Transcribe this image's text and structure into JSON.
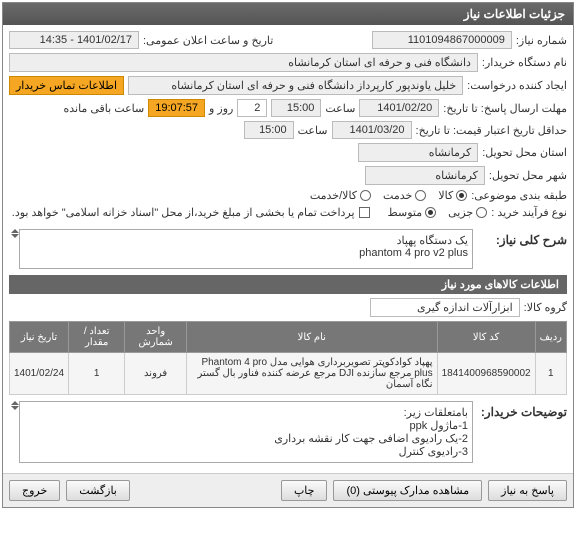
{
  "panel": {
    "title": "جزئیات اطلاعات نیاز"
  },
  "info": {
    "need_number_label": "شماره نیاز:",
    "need_number": "1101094867000009",
    "announce_label": "تاریخ و ساعت اعلان عمومی:",
    "announce_value": "1401/02/17 - 14:35",
    "buyer_name_label": "نام دستگاه خریدار:",
    "buyer_name": "دانشگاه فنی و حرفه ای استان کرمانشاه",
    "requester_label": "ایجاد کننده درخواست:",
    "requester": "خلیل یاوندپور کارپرداز دانشگاه فنی و حرفه ای استان کرمانشاه",
    "contact_btn": "اطلاعات تماس خریدار",
    "deadline_label": "مهلت ارسال پاسخ: تا تاریخ:",
    "deadline_date": "1401/02/20",
    "time_label": "ساعت",
    "deadline_time": "15:00",
    "day_label": "روز و",
    "days": "2",
    "remaining": "19:07:57",
    "remain_label": "ساعت باقی مانده",
    "valid_label": "حداقل تاریخ اعتبار قیمت: تا تاریخ:",
    "valid_date": "1401/03/20",
    "valid_time": "15:00",
    "province_label": "استان محل تحویل:",
    "province": "کرمانشاه",
    "city_label": "شهر محل تحویل:",
    "city": "کرمانشاه",
    "category_label": "طبقه بندی موضوعی:",
    "cat_goods": "کالا",
    "cat_service": "خدمت",
    "cat_goods_service": "کالا/خدمت",
    "process_label": "نوع فرآیند خرید :",
    "proc_small": "جزیی",
    "proc_medium": "متوسط",
    "note": "پرداخت تمام یا بخشی از مبلغ خرید،از محل \"اسناد خزانه اسلامی\" خواهد بود.",
    "desc_label": "شرح کلی نیاز:",
    "desc_text": "یک دستگاه پهپاد\nphantom 4 pro v2 plus"
  },
  "goods": {
    "header": "اطلاعات کالاهای مورد نیاز",
    "group_label": "گروه کالا:",
    "group_value": "ابزارآلات اندازه گیری",
    "columns": [
      "ردیف",
      "کد کالا",
      "نام کالا",
      "واحد شمارش",
      "تعداد / مقدار",
      "تاریخ نیاز"
    ],
    "rows": [
      {
        "idx": "1",
        "code": "1841400968590002",
        "name": "پهپاد کوادکوپتر تصویربرداری هوایی مدل Phantom 4 pro plus مرجع سازنده DJI مرجع عرضه کننده فناور بال گستر نگاه آسمان",
        "unit": "فروند",
        "qty": "1",
        "date": "1401/02/24"
      }
    ],
    "remarks_label": "توضیحات خریدار:",
    "remarks_text": "بامتعلقات زیر:\n1-ماژول ppk\n2-یک رادیوی اضافی جهت کار نقشه برداری\n3-رادیوی کنترل"
  },
  "buttons": {
    "reply": "پاسخ به نیاز",
    "attachments": "مشاهده مدارک پیوستی (0)",
    "print": "چاپ",
    "back": "بازگشت",
    "exit": "خروج"
  }
}
